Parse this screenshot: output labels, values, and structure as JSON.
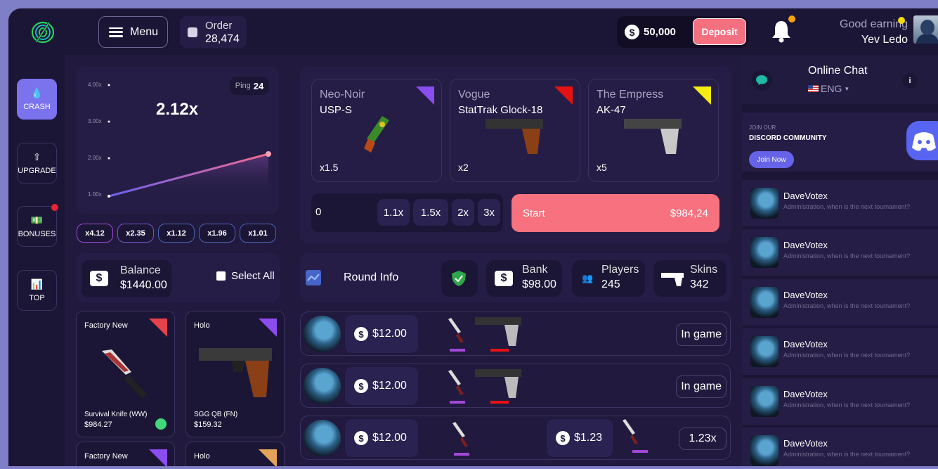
{
  "header": {
    "menu_label": "Menu",
    "order_label": "Order",
    "order_value": "28,474",
    "balance": "50,000",
    "deposit_label": "Deposit",
    "greeting": "Good earning",
    "username": "Yev Ledo"
  },
  "sidebar": {
    "items": [
      {
        "label": "CRASH",
        "icon": "drop-icon",
        "active": true
      },
      {
        "label": "UPGRADE",
        "icon": "arrow-up-icon"
      },
      {
        "label": "BONUSES",
        "icon": "dollar-bill-icon"
      },
      {
        "label": "TOP",
        "icon": "bar-chart-icon"
      }
    ]
  },
  "crash": {
    "multiplier": "2.12x",
    "ping_label": "Ping",
    "ping_value": "24",
    "y_ticks": [
      "4.00x",
      "3.00x",
      "2.00x",
      "1.00x"
    ],
    "history": [
      "x4.12",
      "x2.35",
      "x1.12",
      "x1.96",
      "x1.01"
    ]
  },
  "balance_box": {
    "label": "Balance",
    "value": "$1440.00",
    "select_all": "Select All"
  },
  "inventory": [
    {
      "condition": "Factory New",
      "name": "Survival Knife (WW)",
      "price": "$984.27",
      "tag_color": "#e7434d"
    },
    {
      "condition": "Holo",
      "name": "SGG QB (FN)",
      "price": "$159.32",
      "tag_color": "#8c4df0"
    },
    {
      "condition": "Factory New",
      "tag_color": "#8c4df0"
    },
    {
      "condition": "Holo",
      "tag_color": "#e3a35a"
    }
  ],
  "skins": [
    {
      "name": "Neo-Noir",
      "weapon": "USP-S",
      "multiplier": "x1.5",
      "tag_color": "#8c4df0"
    },
    {
      "name": "Vogue",
      "weapon": "StatTrak Glock-18",
      "multiplier": "x2",
      "tag_color": "#e61212"
    },
    {
      "name": "The Empress",
      "weapon": "AK-47",
      "multiplier": "x5",
      "tag_color": "#f5ec12"
    }
  ],
  "bet": {
    "amount": "0",
    "quick": [
      "1.1x",
      "1.5x",
      "2x",
      "3x"
    ],
    "start_label": "Start",
    "start_value": "$984,24"
  },
  "round": {
    "round_info": "Round Info",
    "bank_label": "Bank",
    "bank_value": "$98.00",
    "players_label": "Players",
    "players_value": "245",
    "skins_label": "Skins",
    "skins_value": "342"
  },
  "rows": [
    {
      "bet": "$12.00",
      "status": "In game"
    },
    {
      "bet": "$12.00",
      "status": "In game"
    },
    {
      "bet": "$12.00",
      "win": "$1.23",
      "status": "1.23x"
    }
  ],
  "chat": {
    "title": "Online Chat",
    "language": "ENG",
    "discord_join": "JOIN OUR",
    "discord_title": "DISCORD COMMUNITY",
    "discord_button": "Join Now",
    "messages": [
      {
        "user": "DaveVotex",
        "text": "Administration, when is the next tournament?"
      },
      {
        "user": "DaveVotex",
        "text": "Administration, when is the next tournament?"
      },
      {
        "user": "DaveVotex",
        "text": "Administration, when is the next tournament?"
      },
      {
        "user": "DaveVotex",
        "text": "Administration, when is the next tournament?"
      },
      {
        "user": "DaveVotex",
        "text": "Administration, when is the next tournament?"
      },
      {
        "user": "DaveVotex",
        "text": "Administration, when is the next tournament?"
      }
    ]
  }
}
